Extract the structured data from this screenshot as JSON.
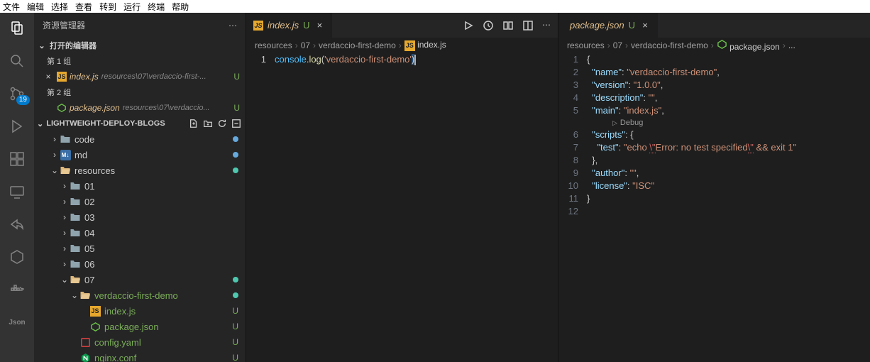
{
  "menubar": [
    "文件",
    "编辑",
    "选择",
    "查看",
    "转到",
    "运行",
    "终端",
    "帮助"
  ],
  "sidebar": {
    "title": "资源管理器",
    "openEditors": {
      "header": "打开的编辑器",
      "groups": [
        {
          "label": "第 1 组",
          "items": [
            {
              "close": true,
              "icon": "js",
              "name": "index.js",
              "path": "resources\\07\\verdaccio-first-...",
              "status": "U"
            }
          ]
        },
        {
          "label": "第 2 组",
          "items": [
            {
              "close": false,
              "icon": "npm",
              "name": "package.json",
              "path": "resources\\07\\verdaccio...",
              "status": "U"
            }
          ]
        }
      ]
    },
    "folder": {
      "name": "LIGHTWEIGHT-DEPLOY-BLOGS",
      "tree": [
        {
          "depth": 1,
          "chev": "›",
          "icon": "folder",
          "label": "code",
          "dot": "#66aadd"
        },
        {
          "depth": 1,
          "chev": "›",
          "icon": "md",
          "label": "md",
          "dot": "#66aadd"
        },
        {
          "depth": 1,
          "chev": "⌄",
          "icon": "folder-open",
          "label": "resources",
          "dot": "#4ec9b0",
          "untracked": false
        },
        {
          "depth": 2,
          "chev": "›",
          "icon": "folder",
          "label": "01"
        },
        {
          "depth": 2,
          "chev": "›",
          "icon": "folder",
          "label": "02"
        },
        {
          "depth": 2,
          "chev": "›",
          "icon": "folder",
          "label": "03"
        },
        {
          "depth": 2,
          "chev": "›",
          "icon": "folder",
          "label": "04"
        },
        {
          "depth": 2,
          "chev": "›",
          "icon": "folder",
          "label": "05"
        },
        {
          "depth": 2,
          "chev": "›",
          "icon": "folder",
          "label": "06"
        },
        {
          "depth": 2,
          "chev": "⌄",
          "icon": "folder-open",
          "label": "07",
          "dot": "#4ec9b0"
        },
        {
          "depth": 3,
          "chev": "⌄",
          "icon": "folder-open",
          "label": "verdaccio-first-demo",
          "untracked": true,
          "dot": "#4ec9b0"
        },
        {
          "depth": 4,
          "chev": "",
          "icon": "js",
          "label": "index.js",
          "untracked": true,
          "statusU": "U"
        },
        {
          "depth": 4,
          "chev": "",
          "icon": "npm",
          "label": "package.json",
          "untracked": true,
          "statusU": "U"
        },
        {
          "depth": 3,
          "chev": "",
          "icon": "yaml",
          "label": "config.yaml",
          "untracked": true,
          "statusU": "U"
        },
        {
          "depth": 3,
          "chev": "",
          "icon": "nginx",
          "label": "nginx.conf",
          "untracked": true,
          "statusU": "U"
        }
      ]
    }
  },
  "scmBadge": "19",
  "editor1": {
    "tab": {
      "icon": "js",
      "name": "index.js",
      "status": "U"
    },
    "breadcrumb": [
      "resources",
      "07",
      "verdaccio-first-demo",
      "index.js"
    ],
    "bcIcon": "js",
    "code": {
      "line": 1,
      "obj": "console",
      "method": "log",
      "str": "'verdaccio-first-demo'"
    }
  },
  "editor2": {
    "tab": {
      "icon": "npm",
      "name": "package.json",
      "status": "U"
    },
    "breadcrumb": [
      "resources",
      "07",
      "verdaccio-first-demo",
      "package.json",
      "..."
    ],
    "bcIcon": "npm",
    "codelens": "Debug",
    "lines": [
      {
        "n": 1,
        "t": [
          {
            "c": "punc",
            "v": "{"
          }
        ]
      },
      {
        "n": 2,
        "t": [
          {
            "c": "key",
            "v": "  \"name\""
          },
          {
            "c": "punc",
            "v": ": "
          },
          {
            "c": "str",
            "v": "\"verdaccio-first-demo\""
          },
          {
            "c": "punc",
            "v": ","
          }
        ]
      },
      {
        "n": 3,
        "t": [
          {
            "c": "key",
            "v": "  \"version\""
          },
          {
            "c": "punc",
            "v": ": "
          },
          {
            "c": "str",
            "v": "\"1.0.0\""
          },
          {
            "c": "punc",
            "v": ","
          }
        ]
      },
      {
        "n": 4,
        "t": [
          {
            "c": "key",
            "v": "  \"description\""
          },
          {
            "c": "punc",
            "v": ": "
          },
          {
            "c": "str",
            "v": "\"\""
          },
          {
            "c": "punc",
            "v": ","
          }
        ]
      },
      {
        "n": 5,
        "t": [
          {
            "c": "key",
            "v": "  \"main\""
          },
          {
            "c": "punc",
            "v": ": "
          },
          {
            "c": "str",
            "v": "\"index.js\""
          },
          {
            "c": "punc",
            "v": ","
          }
        ]
      },
      {
        "n": 6,
        "t": [
          {
            "c": "key",
            "v": "  \"scripts\""
          },
          {
            "c": "punc",
            "v": ": {"
          }
        ]
      },
      {
        "n": 7,
        "t": [
          {
            "c": "key",
            "v": "    \"test\""
          },
          {
            "c": "punc",
            "v": ": "
          },
          {
            "c": "str",
            "v": "\"echo "
          },
          {
            "c": "warn",
            "v": "\\\""
          },
          {
            "c": "str",
            "v": "Error: no test specified"
          },
          {
            "c": "warn",
            "v": "\\\""
          },
          {
            "c": "str",
            "v": " && exit 1\""
          }
        ]
      },
      {
        "n": 8,
        "t": [
          {
            "c": "punc",
            "v": "  },"
          }
        ]
      },
      {
        "n": 9,
        "t": [
          {
            "c": "key",
            "v": "  \"author\""
          },
          {
            "c": "punc",
            "v": ": "
          },
          {
            "c": "str",
            "v": "\"\""
          },
          {
            "c": "punc",
            "v": ","
          }
        ]
      },
      {
        "n": 10,
        "t": [
          {
            "c": "key",
            "v": "  \"license\""
          },
          {
            "c": "punc",
            "v": ": "
          },
          {
            "c": "str",
            "v": "\"ISC\""
          }
        ]
      },
      {
        "n": 11,
        "t": [
          {
            "c": "punc",
            "v": "}"
          }
        ]
      },
      {
        "n": 12,
        "t": []
      }
    ]
  }
}
